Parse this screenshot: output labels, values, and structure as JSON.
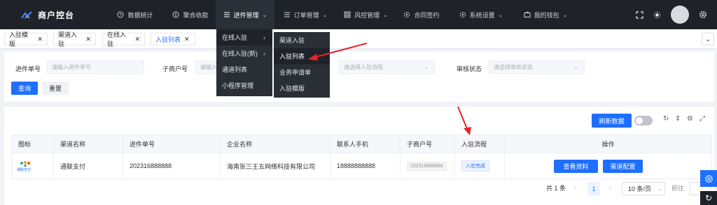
{
  "header": {
    "app_title": "商户控台",
    "nav": [
      {
        "label": "数据统计",
        "icon": "clock-icon"
      },
      {
        "label": "聚合收款",
        "icon": "circle-dollar-icon"
      },
      {
        "label": "进件管理",
        "icon": "list-icon"
      },
      {
        "label": "订单管理",
        "icon": "list-icon"
      },
      {
        "label": "风控管理",
        "icon": "grid-icon"
      },
      {
        "label": "合同签约",
        "icon": "gear-icon"
      },
      {
        "label": "系统设置",
        "icon": "gear-icon"
      },
      {
        "label": "我的钱包",
        "icon": "wallet-icon"
      }
    ]
  },
  "tabs": [
    {
      "label": "入驻模版"
    },
    {
      "label": "渠道入驻"
    },
    {
      "label": "在线入驻"
    },
    {
      "label": "入驻列表"
    }
  ],
  "filter": {
    "order_no_label": "进件单号",
    "order_no_placeholder": "请输入进件单号",
    "sub_merchant_label": "子商户号",
    "sub_merchant_placeholder": "请输入",
    "flow_placeholder": "请选择入驻流程",
    "audit_label": "审核状态",
    "audit_placeholder": "请选择审核状态",
    "query": "查询",
    "reset": "重置"
  },
  "menu": {
    "level1": [
      "在线入驻",
      "在线入驻(新)",
      "通道列表",
      "小程序管理"
    ],
    "level2": [
      "渠道入驻",
      "入驻列表",
      "业务申请单",
      "入驻模版"
    ]
  },
  "toolbar": {
    "refresh": "刷新数据"
  },
  "table": {
    "headers": [
      "图标",
      "渠道名称",
      "进件单号",
      "企业名称",
      "联系人手机",
      "子商户号",
      "入驻流程",
      "操作"
    ],
    "rows": [
      {
        "logo_text": "通联支付",
        "channel": "通联支付",
        "order_no": "202316888888",
        "company": "海南张三王五网络科技有限公司",
        "phone": "18888888888",
        "sub_merchant": "232316888888",
        "flow": "入驻完成",
        "view": "查看资料",
        "config": "渠道配置"
      }
    ]
  },
  "pagination": {
    "total": "共 1 条",
    "page": "1",
    "size": "10 条/页",
    "goto": "前往",
    "prev": "‹",
    "next": "›"
  },
  "colors": {
    "primary": "#1f6fff",
    "topbar": "#1f2329",
    "annotation": "#e5252a"
  }
}
